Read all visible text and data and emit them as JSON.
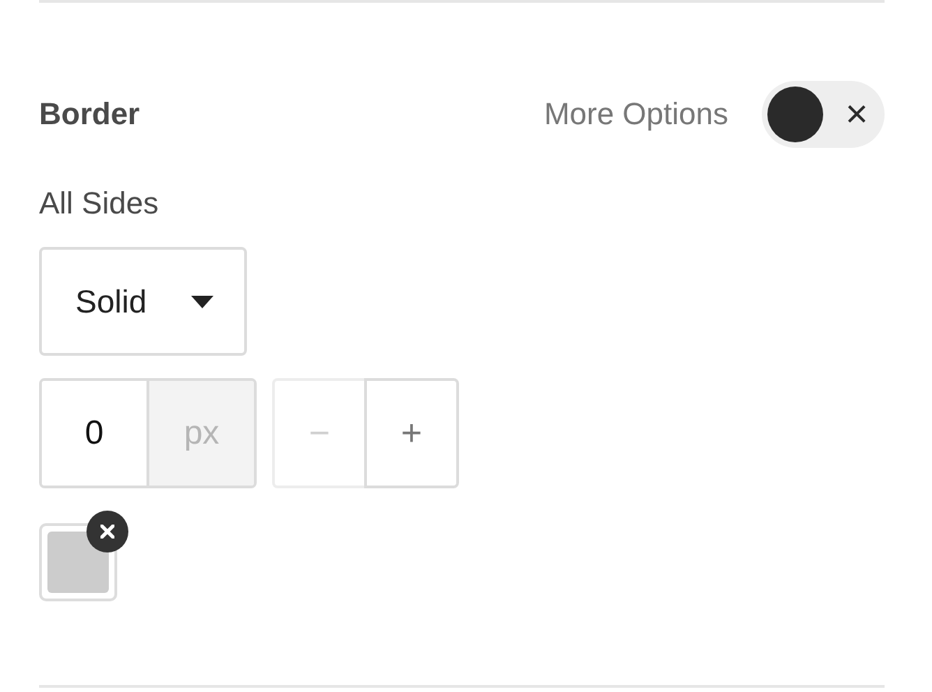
{
  "section": {
    "title": "Border",
    "more_options": {
      "label": "More Options",
      "toggle": {
        "on": false,
        "glyph": "×"
      }
    }
  },
  "sides_label": "All Sides",
  "style_select": {
    "value": "Solid"
  },
  "width_field": {
    "value": "0",
    "unit": "px"
  },
  "stepper": [
    {
      "kind": "minus",
      "glyph": "−",
      "disabled": true
    },
    {
      "kind": "plus",
      "glyph": "+",
      "disabled": false
    }
  ],
  "swatch": {
    "clearable": true
  }
}
